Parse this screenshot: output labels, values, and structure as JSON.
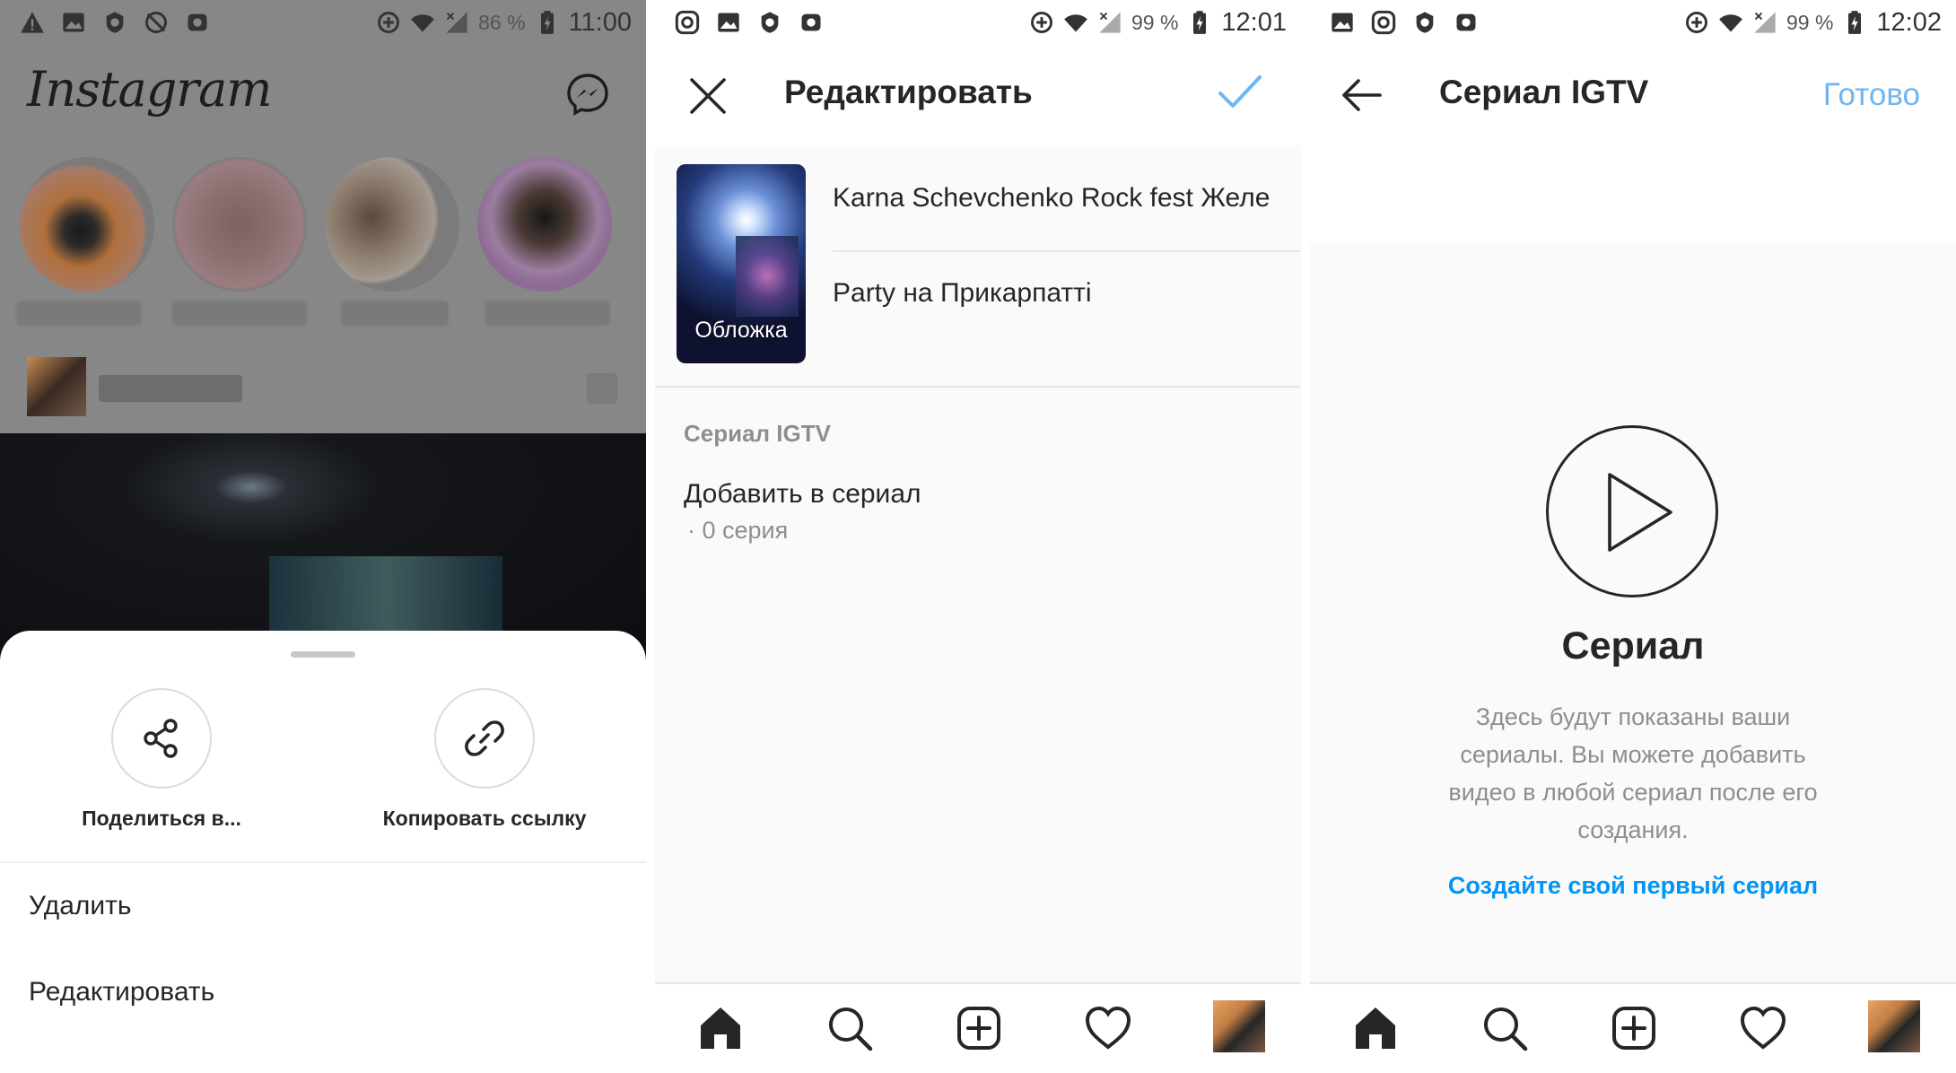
{
  "panel1": {
    "status": {
      "battery_percent": "86 %",
      "time": "11:00"
    },
    "app_name": "Instagram",
    "sheet": {
      "share_label": "Поделиться в...",
      "copy_link_label": "Копировать ссылку",
      "items": [
        "Удалить",
        "Редактировать"
      ]
    }
  },
  "panel2": {
    "status": {
      "battery_percent": "99 %",
      "time": "12:01"
    },
    "title": "Редактировать",
    "cover_label": "Обложка",
    "video_title": "Karna Schevchenko Rock fest Желе",
    "video_description": "Party на Прикарпатті",
    "section_label": "Сериал IGTV",
    "add_to_series": "Добавить в сериал",
    "series_count": "· 0 серия"
  },
  "panel3": {
    "status": {
      "battery_percent": "99 %",
      "time": "12:02"
    },
    "title": "Сериал IGTV",
    "done_label": "Готово",
    "empty_title": "Сериал",
    "empty_description": "Здесь будут показаны ваши сериалы. Вы можете добавить видео в любой сериал после его создания.",
    "create_link": "Создайте свой первый сериал"
  },
  "colors": {
    "accent": "#0095f6",
    "done_disabled": "#6fb6f2",
    "text": "#262626",
    "secondary": "#8e8e8e"
  },
  "icons": [
    "warning-icon",
    "gallery-icon",
    "lion-icon",
    "no-sync-icon",
    "camera-icon",
    "instagram-icon",
    "data-saver-icon",
    "wifi-icon",
    "signal-icon",
    "battery-icon",
    "messenger-icon",
    "share-icon",
    "link-icon",
    "close-icon",
    "check-icon",
    "back-arrow-icon",
    "play-icon",
    "home-icon",
    "search-icon",
    "add-icon",
    "heart-icon"
  ]
}
